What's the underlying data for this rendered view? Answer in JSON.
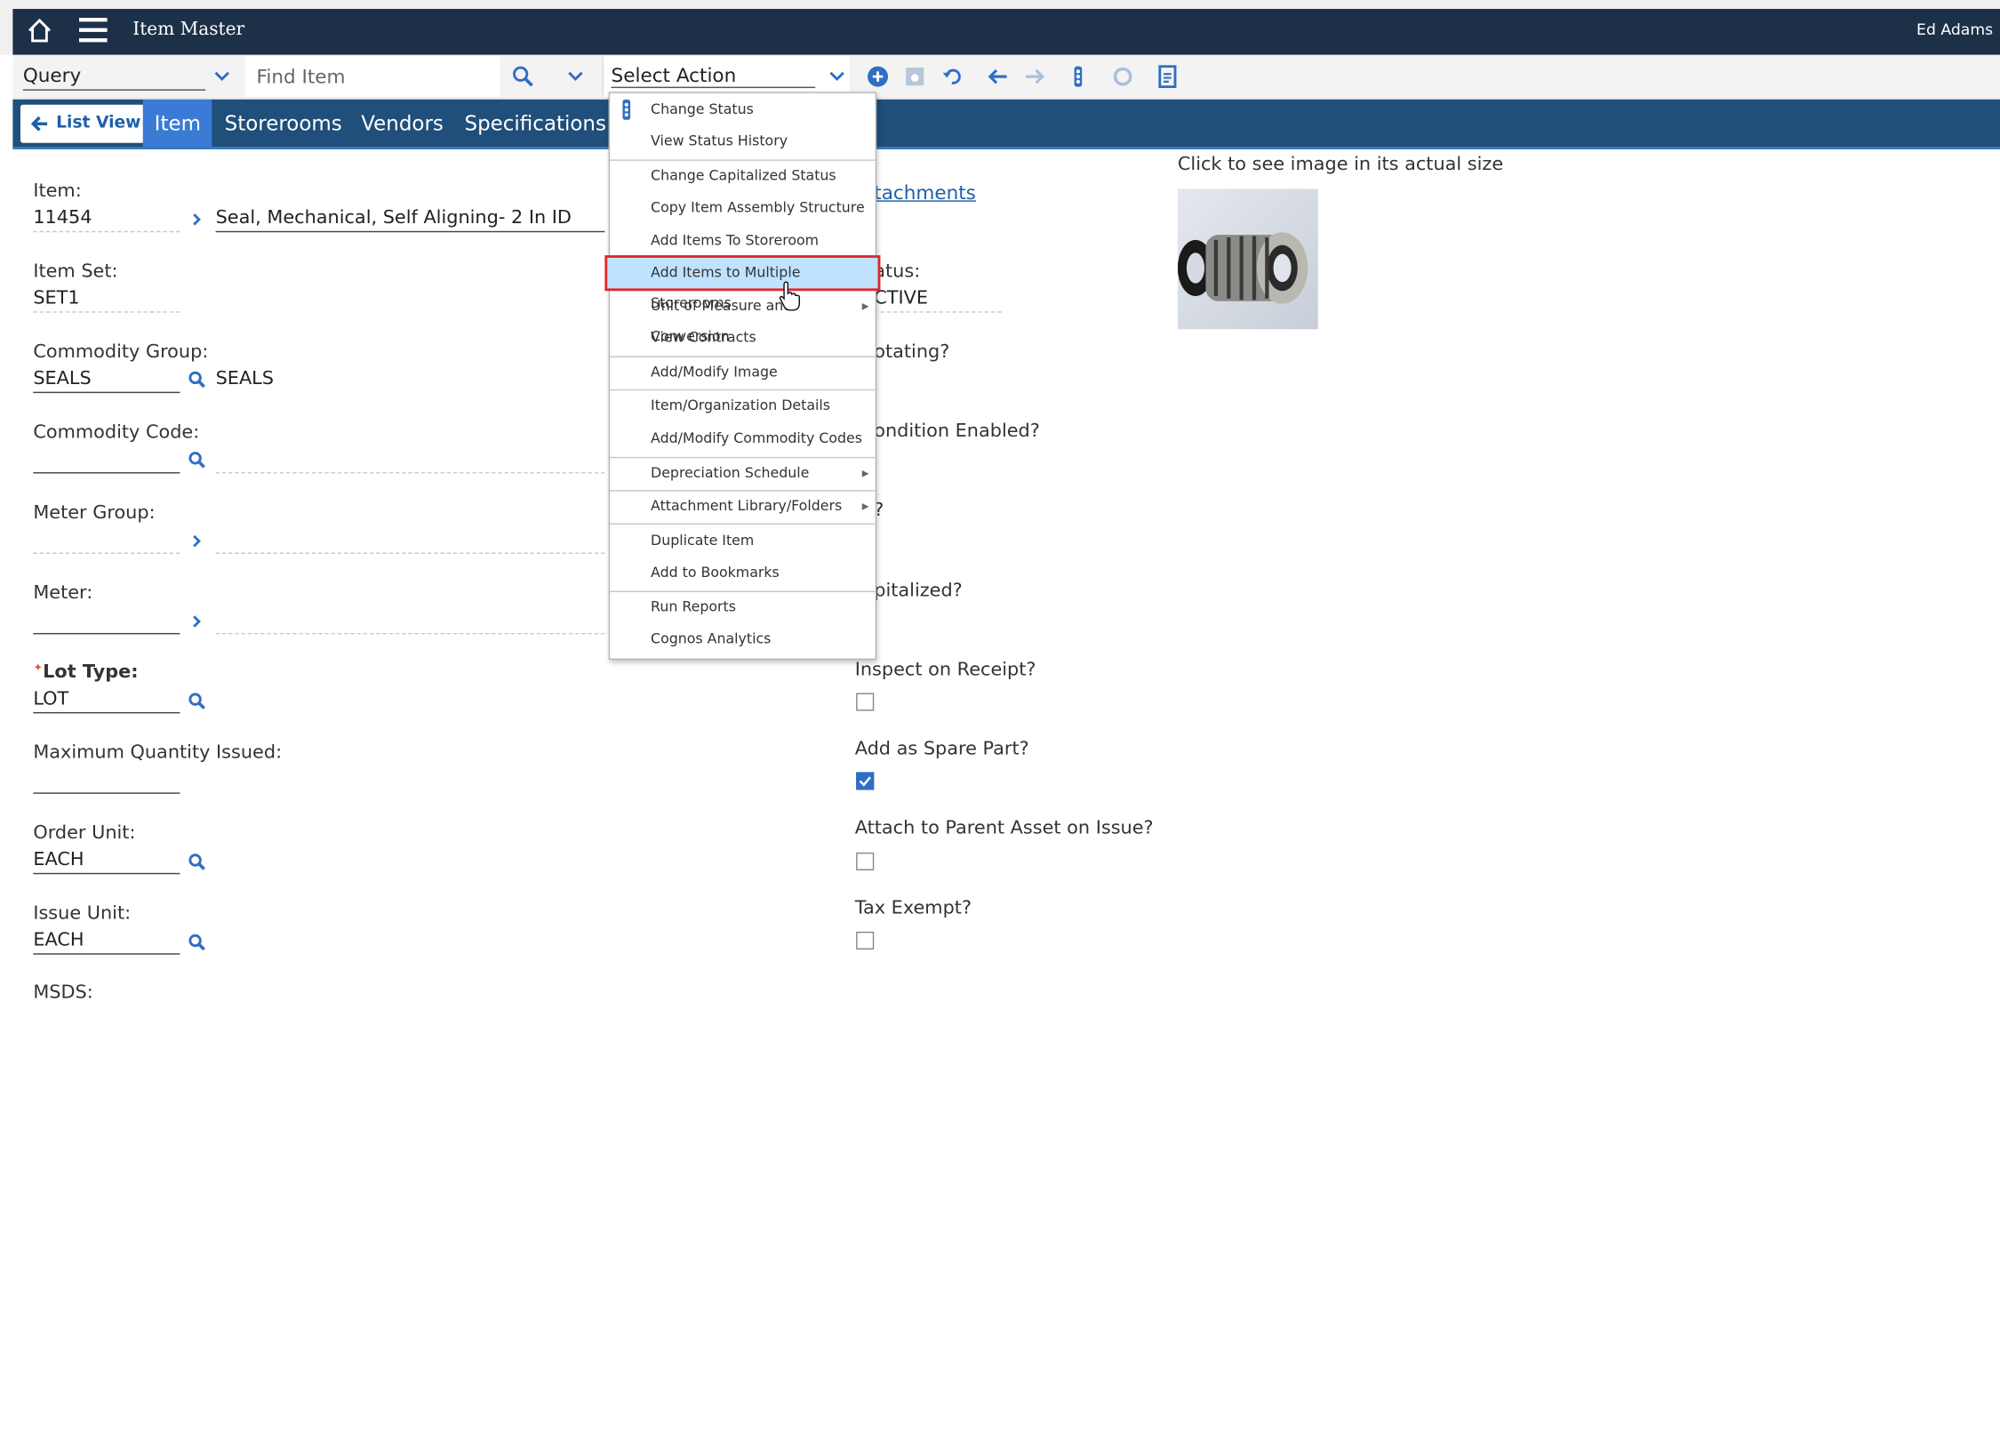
{
  "header": {
    "app_title": "Item Master",
    "user_name": "Ed Adams"
  },
  "toolbar": {
    "query_label": "Query",
    "find_placeholder": "Find Item",
    "select_action_label": "Select Action"
  },
  "tabs": {
    "list_view": "List View",
    "items": [
      "Item",
      "Storerooms",
      "Vendors",
      "Specifications"
    ]
  },
  "form": {
    "item_label": "Item:",
    "item_value": "11454",
    "item_description": "Seal, Mechanical, Self Aligning- 2 In ID",
    "item_set_label": "Item Set:",
    "item_set_value": "SET1",
    "commodity_group_label": "Commodity Group:",
    "commodity_group_value": "SEALS",
    "commodity_group_desc": "SEALS",
    "commodity_code_label": "Commodity Code:",
    "meter_group_label": "Meter Group:",
    "meter_label": "Meter:",
    "lot_type_label": "Lot Type:",
    "lot_type_value": "LOT",
    "max_qty_label": "Maximum Quantity Issued:",
    "order_unit_label": "Order Unit:",
    "order_unit_value": "EACH",
    "issue_unit_label": "Issue Unit:",
    "issue_unit_value": "EACH",
    "msds_label": "MSDS:"
  },
  "right": {
    "attachments_text": "tachments",
    "status_label": "atus:",
    "status_value": "CTIVE",
    "rotating_label": "otating?",
    "condition_label": "ondition Enabled?",
    "kit_label": "?",
    "capitalized_label": "pitalized?",
    "inspect_label": "Inspect on Receipt?",
    "inspect_checked": false,
    "spare_label": "Add as Spare Part?",
    "spare_checked": true,
    "attach_parent_label": "Attach to Parent Asset on Issue?",
    "attach_parent_checked": false,
    "tax_label": "Tax Exempt?",
    "tax_checked": false,
    "image_caption": "Click to see image in its actual size"
  },
  "menu": {
    "items": [
      "Change Status",
      "View Status History",
      "Change Capitalized Status",
      "Copy Item Assembly Structure",
      "Add Items To Storeroom",
      "Add Items to Multiple Storerooms",
      "Unit of Measure and Conversion",
      "View Contracts",
      "Add/Modify Image",
      "Item/Organization Details",
      "Add/Modify Commodity Codes",
      "Depreciation Schedule",
      "Attachment Library/Folders",
      "Duplicate Item",
      "Add to Bookmarks",
      "Run Reports",
      "Cognos Analytics"
    ],
    "highlighted": "Add Items to Multiple Storerooms"
  },
  "colors": {
    "title_bar": "#1c3048",
    "tab_bar": "#1f4f7a",
    "accent": "#3a7bd5",
    "highlight": "#bfe3ff",
    "highlight_border": "#e1262d"
  }
}
